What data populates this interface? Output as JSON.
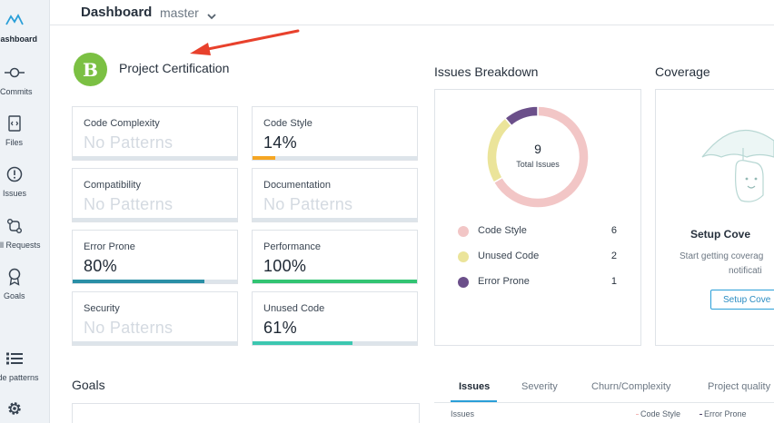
{
  "sidebar": {
    "items": [
      {
        "label": "Dashboard",
        "icon": "dashboard-icon"
      },
      {
        "label": "Commits",
        "icon": "commit-icon"
      },
      {
        "label": "Files",
        "icon": "file-code-icon"
      },
      {
        "label": "Issues",
        "icon": "alert-circle-icon"
      },
      {
        "label": "Pull Requests",
        "icon": "pull-request-icon"
      },
      {
        "label": "Goals",
        "icon": "award-icon"
      },
      {
        "label": "Code patterns",
        "icon": "list-icon"
      },
      {
        "label": "",
        "icon": "gear-icon"
      }
    ]
  },
  "header": {
    "title": "Dashboard",
    "branch": "master"
  },
  "certification": {
    "grade": "B",
    "title": "Project Certification",
    "grade_color": "#7bc043",
    "metrics": [
      {
        "name": "Code Complexity",
        "value": "No Patterns",
        "percent": null
      },
      {
        "name": "Code Style",
        "value": "14%",
        "percent": 14,
        "color": "#f5a623"
      },
      {
        "name": "Compatibility",
        "value": "No Patterns",
        "percent": null
      },
      {
        "name": "Documentation",
        "value": "No Patterns",
        "percent": null
      },
      {
        "name": "Error Prone",
        "value": "80%",
        "percent": 80,
        "color": "#2a8fa6"
      },
      {
        "name": "Performance",
        "value": "100%",
        "percent": 100,
        "color": "#32c472"
      },
      {
        "name": "Security",
        "value": "No Patterns",
        "percent": null
      },
      {
        "name": "Unused Code",
        "value": "61%",
        "percent": 61,
        "color": "#3cc7b0"
      }
    ]
  },
  "issues_breakdown": {
    "title": "Issues Breakdown",
    "total": "9",
    "total_label": "Total Issues",
    "categories": [
      {
        "name": "Code Style",
        "count": "6",
        "color": "#f2c6c6"
      },
      {
        "name": "Unused Code",
        "count": "2",
        "color": "#ebe49a"
      },
      {
        "name": "Error Prone",
        "count": "1",
        "color": "#6b4f8a"
      }
    ]
  },
  "coverage": {
    "title": "Coverage",
    "setup_title": "Setup Cove",
    "text_line1": "Start getting coverag",
    "text_line2": "notificati",
    "button": "Setup Cove"
  },
  "goals": {
    "title": "Goals"
  },
  "tabs": [
    {
      "label": "Issues",
      "active": true
    },
    {
      "label": "Severity",
      "active": false
    },
    {
      "label": "Churn/Complexity",
      "active": false
    },
    {
      "label": "Project quality",
      "active": false
    }
  ],
  "bottom": {
    "y_label": "Issues",
    "legend": [
      "Code Style",
      "Error Prone"
    ]
  }
}
